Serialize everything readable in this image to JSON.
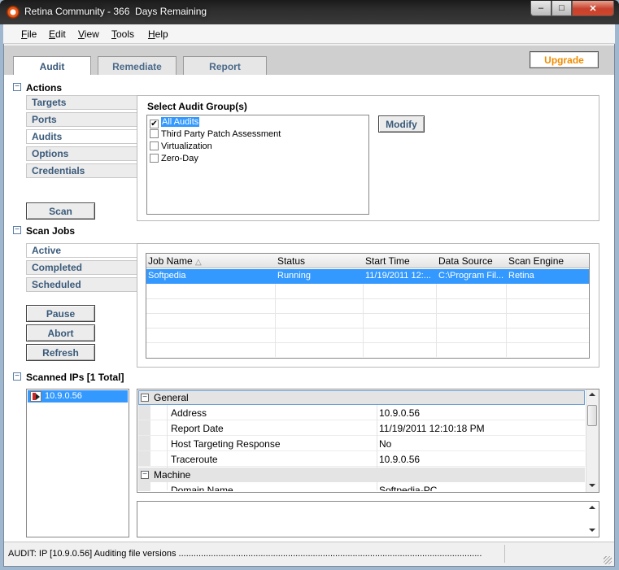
{
  "window": {
    "title": "Retina Community - 366  Days Remaining",
    "minimize_glyph": "–",
    "maximize_glyph": "□",
    "close_glyph": "✕"
  },
  "menu": [
    {
      "accel": "F",
      "rest": "ile"
    },
    {
      "accel": "E",
      "rest": "dit"
    },
    {
      "accel": "V",
      "rest": "iew"
    },
    {
      "accel": "T",
      "rest": "ools"
    },
    {
      "accel": "H",
      "rest": "elp"
    }
  ],
  "tabs": [
    "Audit",
    "Remediate",
    "Report"
  ],
  "upgrade_label": "Upgrade",
  "collapse_glyph": "−",
  "actions": {
    "title": "Actions",
    "items": [
      "Targets",
      "Ports",
      "Audits",
      "Options",
      "Credentials"
    ],
    "scan_label": "Scan",
    "audit_group_title": "Select Audit Group(s)",
    "audit_groups": [
      {
        "label": "All Audits",
        "checked": true,
        "selected": true
      },
      {
        "label": "Third Party Patch Assessment",
        "checked": false,
        "selected": false
      },
      {
        "label": "Virtualization",
        "checked": false,
        "selected": false
      },
      {
        "label": "Zero-Day",
        "checked": false,
        "selected": false
      }
    ],
    "modify_label": "Modify"
  },
  "scan_jobs": {
    "title": "Scan Jobs",
    "items": [
      "Active",
      "Completed",
      "Scheduled"
    ],
    "buttons": [
      "Pause",
      "Abort",
      "Refresh"
    ],
    "columns": [
      "Job Name",
      "Status",
      "Start Time",
      "Data Source",
      "Scan Engine"
    ],
    "sort_glyph": "△",
    "rows": [
      [
        "Softpedia",
        "Running",
        "11/19/2011 12:...",
        "C:\\Program Fil...",
        "Retina"
      ]
    ]
  },
  "scanned": {
    "title": "Scanned IPs [1 Total]",
    "ips": [
      "10.9.0.56"
    ],
    "categories": [
      {
        "name": "General",
        "rows": [
          {
            "key": "Address",
            "value": "10.9.0.56"
          },
          {
            "key": "Report Date",
            "value": "11/19/2011 12:10:18 PM"
          },
          {
            "key": "Host Targeting Response",
            "value": "No"
          },
          {
            "key": "Traceroute",
            "value": "10.9.0.56"
          }
        ]
      },
      {
        "name": "Machine",
        "rows": [
          {
            "key": "Domain Name",
            "value": "Softpedia-PC"
          }
        ]
      }
    ]
  },
  "status": "AUDIT: IP [10.9.0.56] Auditing file versions ..........................................................................................................................",
  "colors": {
    "accent": "#3399ff",
    "upgrade": "#f08c00",
    "section_link": "#3a5a7a"
  }
}
